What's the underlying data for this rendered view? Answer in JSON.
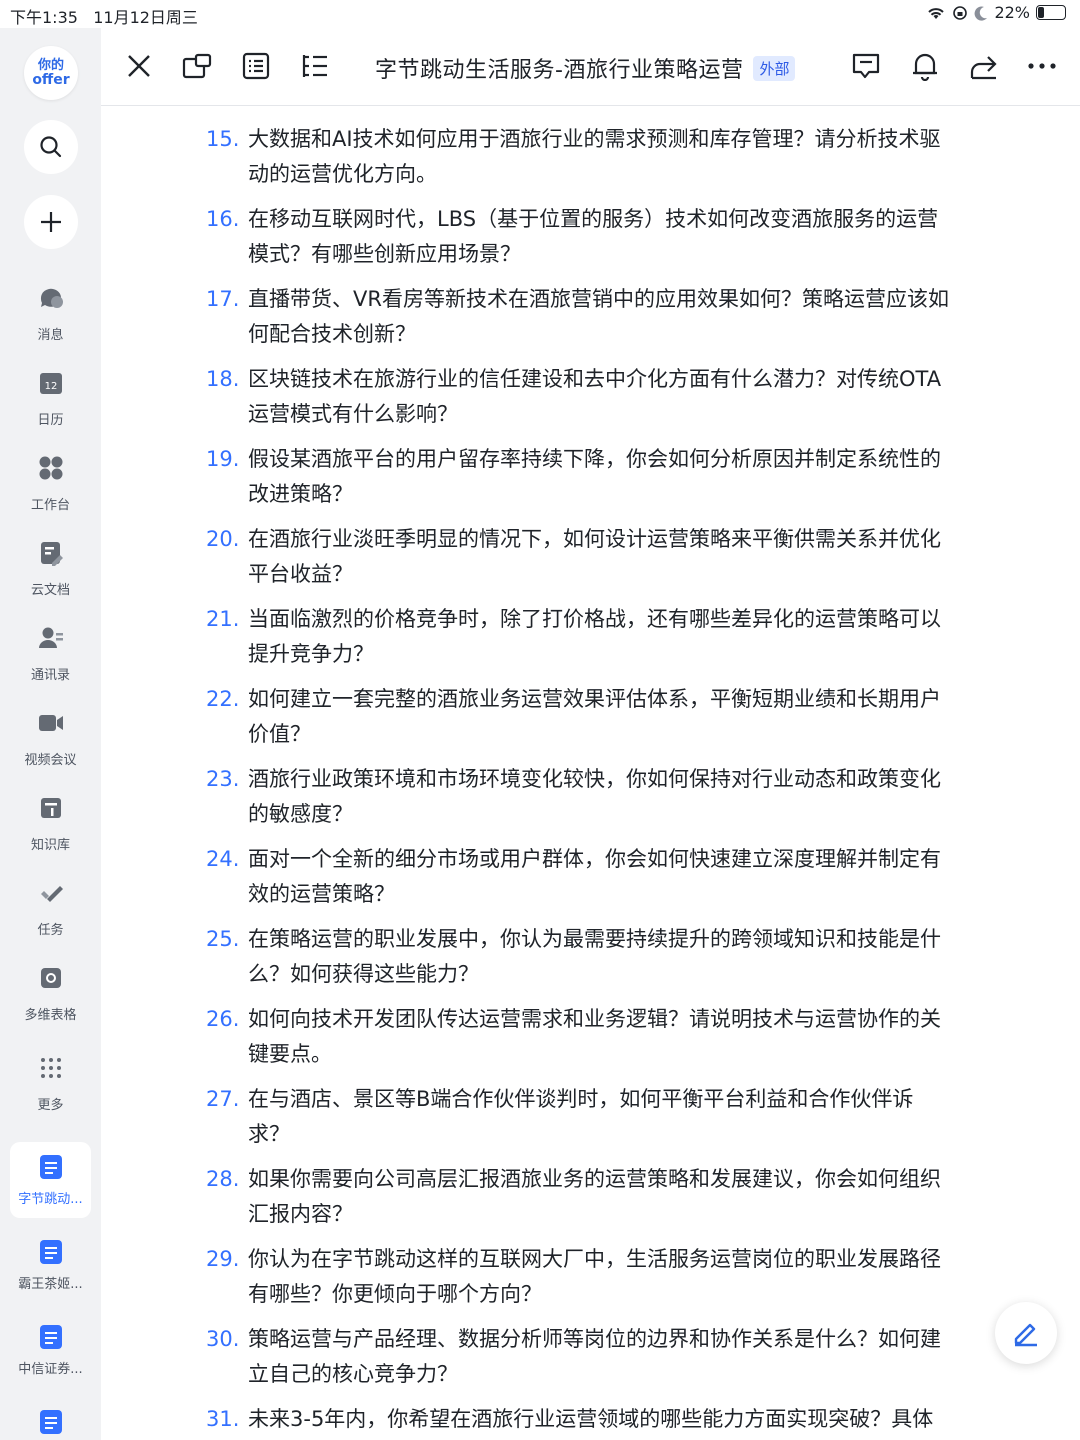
{
  "status_bar": {
    "time": "下午1:35",
    "date": "11月12日周三",
    "battery": "22%",
    "battery_level": 0.22
  },
  "sidebar": {
    "logo_line1": "你的",
    "logo_line2": "offer",
    "nav": [
      {
        "label": "消息",
        "icon": "chat-bubble-icon"
      },
      {
        "label": "日历",
        "icon": "calendar-icon",
        "icon_text": "12"
      },
      {
        "label": "工作台",
        "icon": "workbench-icon"
      },
      {
        "label": "云文档",
        "icon": "cloud-doc-icon"
      },
      {
        "label": "通讯录",
        "icon": "contacts-icon"
      },
      {
        "label": "视频会议",
        "icon": "video-icon"
      },
      {
        "label": "知识库",
        "icon": "knowledge-icon"
      },
      {
        "label": "任务",
        "icon": "task-icon"
      },
      {
        "label": "多维表格",
        "icon": "base-icon"
      },
      {
        "label": "更多",
        "icon": "more-grid-icon"
      }
    ],
    "docs": [
      {
        "label": "字节跳动...",
        "active": true
      },
      {
        "label": "霸王茶姬...",
        "active": false
      },
      {
        "label": "中信证券...",
        "active": false
      }
    ]
  },
  "header": {
    "title": "字节跳动生活服务-酒旅行业策略运营",
    "badge": "外部"
  },
  "questions": [
    {
      "num": "15.",
      "line1": "大数据和AI技术如何应用于酒旅行业的需求预测和库存管理？请分析技术驱",
      "line2": "动的运营优化方向。"
    },
    {
      "num": "16.",
      "line1": "在移动互联网时代，LBS（基于位置的服务）技术如何改变酒旅服务的运营",
      "line2": "模式？有哪些创新应用场景？"
    },
    {
      "num": "17.",
      "line1": "直播带货、VR看房等新技术在酒旅营销中的应用效果如何？策略运营应该如",
      "line2": "何配合技术创新？"
    },
    {
      "num": "18.",
      "line1": "区块链技术在旅游行业的信任建设和去中介化方面有什么潜力？对传统OTA",
      "line2": "运营模式有什么影响？"
    },
    {
      "num": "19.",
      "line1": "假设某酒旅平台的用户留存率持续下降，你会如何分析原因并制定系统性的",
      "line2": "改进策略？"
    },
    {
      "num": "20.",
      "line1": "在酒旅行业淡旺季明显的情况下，如何设计运营策略来平衡供需关系并优化",
      "line2": "平台收益？"
    },
    {
      "num": "21.",
      "line1": "当面临激烈的价格竞争时，除了打价格战，还有哪些差异化的运营策略可以",
      "line2": "提升竞争力？"
    },
    {
      "num": "22.",
      "line1": "如何建立一套完整的酒旅业务运营效果评估体系，平衡短期业绩和长期用户",
      "line2": "价值？"
    },
    {
      "num": "23.",
      "line1": "酒旅行业政策环境和市场环境变化较快，你如何保持对行业动态和政策变化",
      "line2": "的敏感度？"
    },
    {
      "num": "24.",
      "line1": "面对一个全新的细分市场或用户群体，你会如何快速建立深度理解并制定有",
      "line2": "效的运营策略？"
    },
    {
      "num": "25.",
      "line1": "在策略运营的职业发展中，你认为最需要持续提升的跨领域知识和技能是什",
      "line2": "么？如何获得这些能力？"
    },
    {
      "num": "26.",
      "line1": "如何向技术开发团队传达运营需求和业务逻辑？请说明技术与运营协作的关",
      "line2": "键要点。"
    },
    {
      "num": "27.",
      "line1": "在与酒店、景区等B端合作伙伴谈判时，如何平衡平台利益和合作伙伴诉",
      "line2": "求？"
    },
    {
      "num": "28.",
      "line1": "如果你需要向公司高层汇报酒旅业务的运营策略和发展建议，你会如何组织",
      "line2": "汇报内容？"
    },
    {
      "num": "29.",
      "line1": "你认为在字节跳动这样的互联网大厂中，生活服务运营岗位的职业发展路径",
      "line2": "有哪些？你更倾向于哪个方向？"
    },
    {
      "num": "30.",
      "line1": "策略运营与产品经理、数据分析师等岗位的边界和协作关系是什么？如何建",
      "line2": "立自己的核心竞争力？"
    },
    {
      "num": "31.",
      "line1": "未来3-5年内，你希望在酒旅行业运营领域的哪些能力方面实现突破？具体",
      "line2": ""
    }
  ]
}
